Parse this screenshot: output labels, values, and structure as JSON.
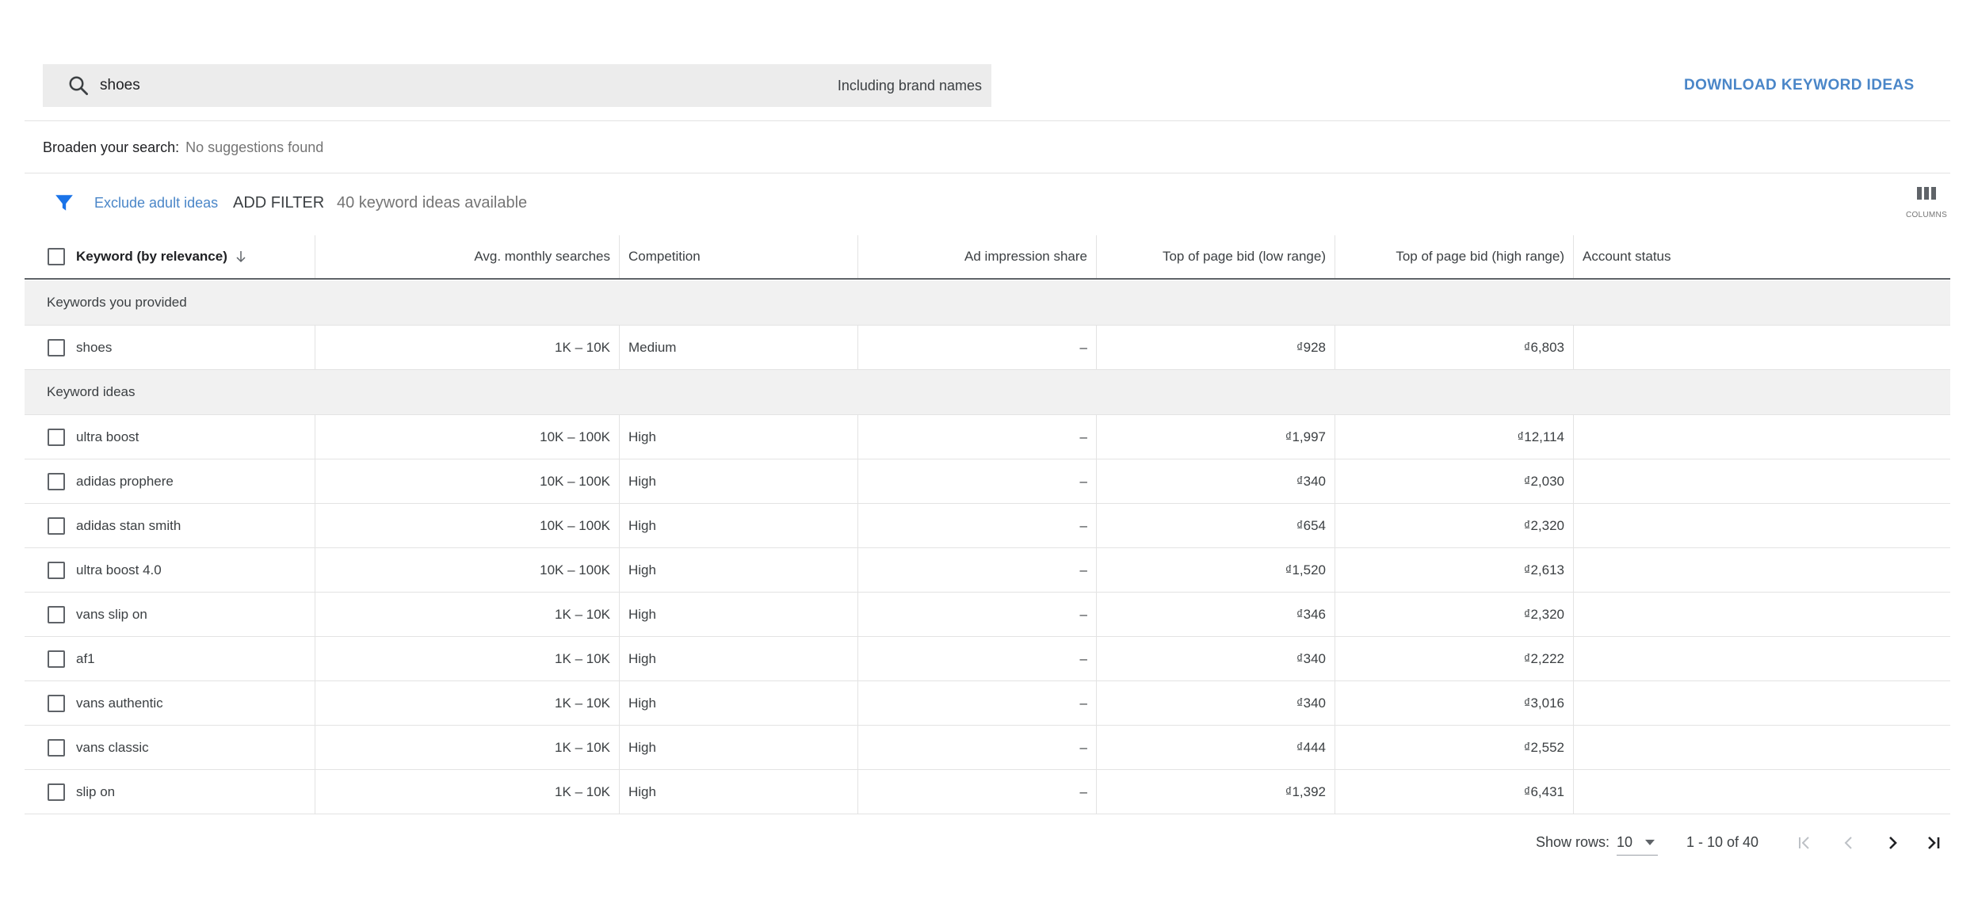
{
  "search": {
    "value": "shoes",
    "brand_toggle": "Including brand names"
  },
  "download_label": "DOWNLOAD KEYWORD IDEAS",
  "broaden": {
    "label": "Broaden your search:",
    "value": "No suggestions found"
  },
  "toolbar": {
    "exclude_adult": "Exclude adult ideas",
    "add_filter": "ADD FILTER",
    "ideas_count": "40 keyword ideas available",
    "columns_label": "COLUMNS"
  },
  "table": {
    "headers": {
      "keyword": "Keyword (by relevance)",
      "avg_searches": "Avg. monthly searches",
      "competition": "Competition",
      "impression_share": "Ad impression share",
      "bid_low": "Top of page bid (low range)",
      "bid_high": "Top of page bid (high range)",
      "account_status": "Account status"
    },
    "groups": [
      {
        "label": "Keywords you provided",
        "rows": [
          {
            "keyword": "shoes",
            "avg": "1K – 10K",
            "competition": "Medium",
            "impression": "–",
            "low": "₫928",
            "high": "₫6,803",
            "status": ""
          }
        ]
      },
      {
        "label": "Keyword ideas",
        "rows": [
          {
            "keyword": "ultra boost",
            "avg": "10K – 100K",
            "competition": "High",
            "impression": "–",
            "low": "₫1,997",
            "high": "₫12,114",
            "status": ""
          },
          {
            "keyword": "adidas prophere",
            "avg": "10K – 100K",
            "competition": "High",
            "impression": "–",
            "low": "₫340",
            "high": "₫2,030",
            "status": ""
          },
          {
            "keyword": "adidas stan smith",
            "avg": "10K – 100K",
            "competition": "High",
            "impression": "–",
            "low": "₫654",
            "high": "₫2,320",
            "status": ""
          },
          {
            "keyword": "ultra boost 4.0",
            "avg": "10K – 100K",
            "competition": "High",
            "impression": "–",
            "low": "₫1,520",
            "high": "₫2,613",
            "status": ""
          },
          {
            "keyword": "vans slip on",
            "avg": "1K – 10K",
            "competition": "High",
            "impression": "–",
            "low": "₫346",
            "high": "₫2,320",
            "status": ""
          },
          {
            "keyword": "af1",
            "avg": "1K – 10K",
            "competition": "High",
            "impression": "–",
            "low": "₫340",
            "high": "₫2,222",
            "status": ""
          },
          {
            "keyword": "vans authentic",
            "avg": "1K – 10K",
            "competition": "High",
            "impression": "–",
            "low": "₫340",
            "high": "₫3,016",
            "status": ""
          },
          {
            "keyword": "vans classic",
            "avg": "1K – 10K",
            "competition": "High",
            "impression": "–",
            "low": "₫444",
            "high": "₫2,552",
            "status": ""
          },
          {
            "keyword": "slip on",
            "avg": "1K – 10K",
            "competition": "High",
            "impression": "–",
            "low": "₫1,392",
            "high": "₫6,431",
            "status": ""
          }
        ]
      }
    ]
  },
  "pagination": {
    "show_rows_label": "Show rows:",
    "rows_value": "10",
    "range": "1 - 10 of 40"
  },
  "colors": {
    "accent": "#4a86c8",
    "filter_icon": "#1a73e8"
  },
  "icons": [
    "search-icon",
    "funnel-filter-icon",
    "columns-icon",
    "sort-arrow-down-icon",
    "chevron-down-icon",
    "first-page-icon",
    "previous-page-icon",
    "next-page-icon",
    "last-page-icon"
  ]
}
